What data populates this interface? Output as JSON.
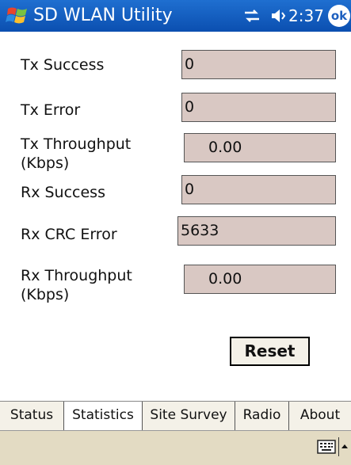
{
  "titlebar": {
    "title": "SD WLAN Utility",
    "time": "2:37",
    "ok_label": "ok"
  },
  "stats": [
    {
      "label": "Tx Success",
      "value": "0"
    },
    {
      "label": "Tx Error",
      "value": "0"
    },
    {
      "label": "Tx Throughput\n(Kbps)",
      "value": "0.00"
    },
    {
      "label": "Rx Success",
      "value": "0"
    },
    {
      "label": "Rx CRC Error",
      "value": "5633"
    },
    {
      "label": "Rx Throughput\n(Kbps)",
      "value": "0.00"
    }
  ],
  "reset_label": "Reset",
  "tabs": [
    {
      "label": "Status"
    },
    {
      "label": "Statistics",
      "active": true
    },
    {
      "label": "Site Survey"
    },
    {
      "label": "Radio"
    },
    {
      "label": "About"
    }
  ],
  "colors": {
    "titlebar": "#0b4fb0",
    "field_bg": "#d9c8c3",
    "bottombar": "#e3dbc3"
  }
}
